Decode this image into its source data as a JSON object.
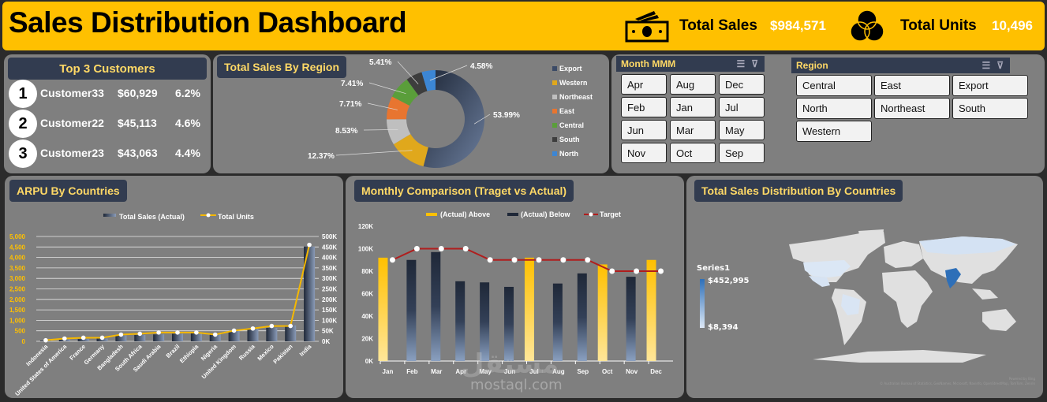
{
  "header": {
    "title": "Sales Distribution Dashboard",
    "total_sales_label": "Total Sales",
    "total_sales_value": "$984,571",
    "total_units_label": "Total Units",
    "total_units_value": "10,496",
    "icons": [
      "money-icon",
      "venn-icon"
    ]
  },
  "top_customers": {
    "title": "Top  3 Customers",
    "rows": [
      {
        "rank": "1",
        "name": "Customer33",
        "sales": "$60,929",
        "share": "6.2%"
      },
      {
        "rank": "2",
        "name": "Customer22",
        "sales": "$45,113",
        "share": "4.6%"
      },
      {
        "rank": "3",
        "name": "Customer23",
        "sales": "$43,063",
        "share": "4.4%"
      }
    ]
  },
  "region_filter": {
    "title": "Region",
    "items": [
      "Central",
      "East",
      "Export",
      "North",
      "Northeast",
      "South",
      "Western"
    ]
  },
  "month_filter": {
    "title": "Month MMM",
    "items": [
      "Apr",
      "Aug",
      "Dec",
      "Feb",
      "Jan",
      "Jul",
      "Jun",
      "Mar",
      "May",
      "Nov",
      "Oct",
      "Sep"
    ]
  },
  "map": {
    "title": "Total Sales Distribution By Countries",
    "legend_title": "Series1",
    "legend_max": "$452,995",
    "legend_min": "$8,394",
    "attribution_1": "Powered by Bing",
    "attribution_2": "© Australian Bureau of Statistics, GeoNames, Microsoft, Navinfo, OpenStreetMap, TomTom, Zenrin"
  },
  "watermark": {
    "arabic": "مستقل",
    "latin": "mostaql.com"
  },
  "chart_data": [
    {
      "type": "pie",
      "title": "Total Sales By Region",
      "donut": true,
      "categories": [
        "Export",
        "Western",
        "Northeast",
        "East",
        "Central",
        "South",
        "North"
      ],
      "values": [
        53.99,
        12.37,
        8.53,
        7.71,
        7.41,
        5.41,
        4.58
      ],
      "labels": [
        "53.99%",
        "12.37%",
        "8.53%",
        "7.71%",
        "7.41%",
        "5.41%",
        "4.58%"
      ],
      "colors": [
        "#3b4a66",
        "#e0a81c",
        "#bfbfbf",
        "#e87530",
        "#5a9e3a",
        "#3d3d3d",
        "#3c86d4"
      ],
      "legend": "right"
    },
    {
      "type": "bar",
      "title": "ARPU By Countries",
      "categories": [
        "Indonesia",
        "United States of America",
        "France",
        "Germany",
        "Bangladesh",
        "South Africa",
        "Saudi Arabia",
        "Brazil",
        "Ethiopia",
        "Nigeria",
        "United Kingdom",
        "Russia",
        "Mexico",
        "Pakistan",
        "India"
      ],
      "series": [
        {
          "name": "Total Sales (Actual)",
          "axis": "left",
          "values": [
            30,
            90,
            110,
            130,
            280,
            300,
            330,
            360,
            380,
            330,
            480,
            590,
            640,
            760,
            4520
          ]
        },
        {
          "name": "Total Units",
          "axis": "right",
          "type": "line",
          "values": [
            5000,
            13000,
            17000,
            17000,
            32000,
            36000,
            42000,
            42000,
            42000,
            32000,
            51000,
            61000,
            73000,
            73000,
            460000
          ]
        }
      ],
      "left_axis": {
        "ticks": [
          "0",
          "500",
          "1,000",
          "1,500",
          "2,000",
          "2,500",
          "3,000",
          "3,500",
          "4,000",
          "4,500",
          "5,000"
        ],
        "range": [
          0,
          5000
        ]
      },
      "right_axis": {
        "ticks": [
          "0K",
          "50K",
          "100K",
          "150K",
          "200K",
          "250K",
          "300K",
          "350K",
          "400K",
          "450K",
          "500K"
        ],
        "range": [
          0,
          500000
        ]
      },
      "legend": "top",
      "grid": true
    },
    {
      "type": "bar",
      "title": "Monthly Comparison (Traget vs Actual)",
      "categories": [
        "Jan",
        "Feb",
        "Mar",
        "Apr",
        "May",
        "Jun",
        "Jul",
        "Aug",
        "Sep",
        "Oct",
        "Nov",
        "Dec"
      ],
      "series": [
        {
          "name": "(Actual) Above",
          "values": [
            92000,
            null,
            null,
            null,
            null,
            null,
            92000,
            null,
            null,
            86000,
            null,
            90000
          ]
        },
        {
          "name": "(Actual) Below",
          "values": [
            null,
            90000,
            97000,
            71000,
            70000,
            66000,
            null,
            69000,
            78000,
            null,
            75000,
            null
          ]
        },
        {
          "name": "Target",
          "type": "line",
          "values": [
            90000,
            100000,
            100000,
            100000,
            90000,
            90000,
            90000,
            90000,
            90000,
            80000,
            80000,
            80000
          ]
        }
      ],
      "y_axis": {
        "ticks": [
          "0K",
          "20K",
          "40K",
          "60K",
          "80K",
          "100K",
          "120K"
        ],
        "range": [
          0,
          120000
        ]
      },
      "legend": "top",
      "grid": false
    }
  ]
}
